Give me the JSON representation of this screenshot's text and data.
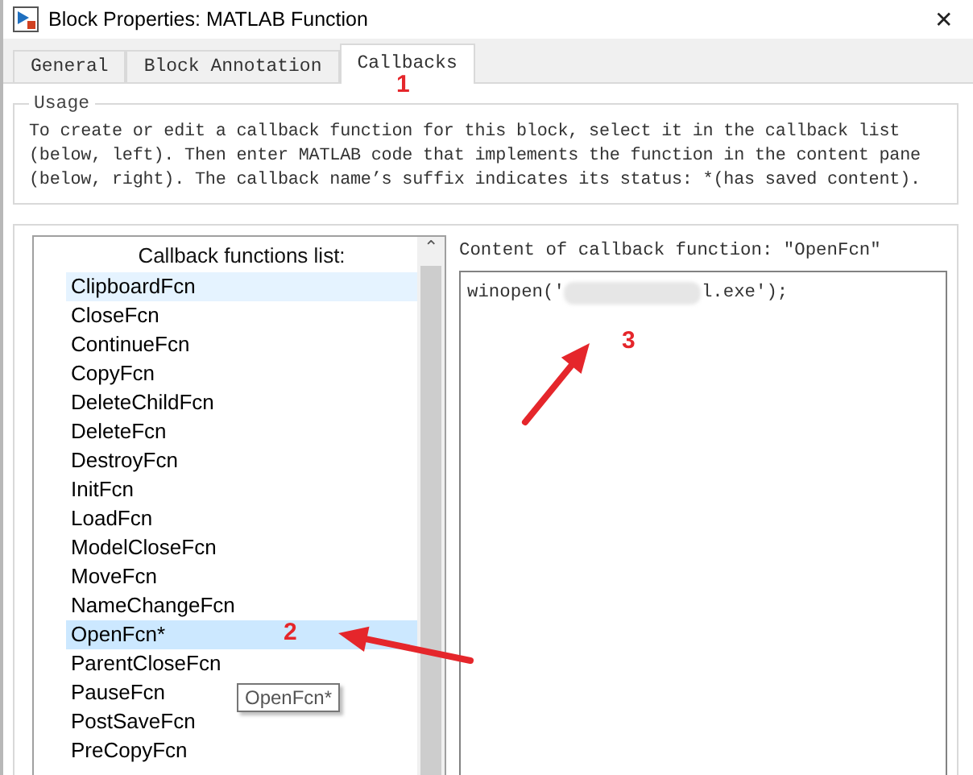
{
  "window": {
    "title": "Block Properties: MATLAB Function",
    "close": "✕"
  },
  "tabs": [
    {
      "label": "General",
      "selected": false
    },
    {
      "label": "Block Annotation",
      "selected": false
    },
    {
      "label": "Callbacks",
      "selected": true
    }
  ],
  "usage": {
    "legend": "Usage",
    "text": "To create or edit a callback function for this block, select it in the callback list (below, left). Then enter MATLAB code that implements the function in the content pane (below, right). The callback name’s suffix indicates its status: *(has saved content)."
  },
  "callback_list": {
    "heading": "Callback functions list:",
    "scroll_up": "⌃",
    "items": [
      {
        "label": "ClipboardFcn",
        "selected": false,
        "hovered": true
      },
      {
        "label": "CloseFcn",
        "selected": false,
        "hovered": false
      },
      {
        "label": "ContinueFcn",
        "selected": false,
        "hovered": false
      },
      {
        "label": "CopyFcn",
        "selected": false,
        "hovered": false
      },
      {
        "label": "DeleteChildFcn",
        "selected": false,
        "hovered": false
      },
      {
        "label": "DeleteFcn",
        "selected": false,
        "hovered": false
      },
      {
        "label": "DestroyFcn",
        "selected": false,
        "hovered": false
      },
      {
        "label": "InitFcn",
        "selected": false,
        "hovered": false
      },
      {
        "label": "LoadFcn",
        "selected": false,
        "hovered": false
      },
      {
        "label": "ModelCloseFcn",
        "selected": false,
        "hovered": false
      },
      {
        "label": "MoveFcn",
        "selected": false,
        "hovered": false
      },
      {
        "label": "NameChangeFcn",
        "selected": false,
        "hovered": false
      },
      {
        "label": "OpenFcn*",
        "selected": true,
        "hovered": false
      },
      {
        "label": "ParentCloseFcn",
        "selected": false,
        "hovered": false
      },
      {
        "label": "PauseFcn",
        "selected": false,
        "hovered": false
      },
      {
        "label": "PostSaveFcn",
        "selected": false,
        "hovered": false
      },
      {
        "label": "PreCopyFcn",
        "selected": false,
        "hovered": false
      }
    ],
    "tooltip": "OpenFcn*"
  },
  "content": {
    "heading": "Content of callback function: ″OpenFcn″",
    "code_before": "winopen('",
    "code_after": "l.exe');"
  },
  "annotations": [
    {
      "label": "1"
    },
    {
      "label": "2"
    },
    {
      "label": "3"
    }
  ]
}
